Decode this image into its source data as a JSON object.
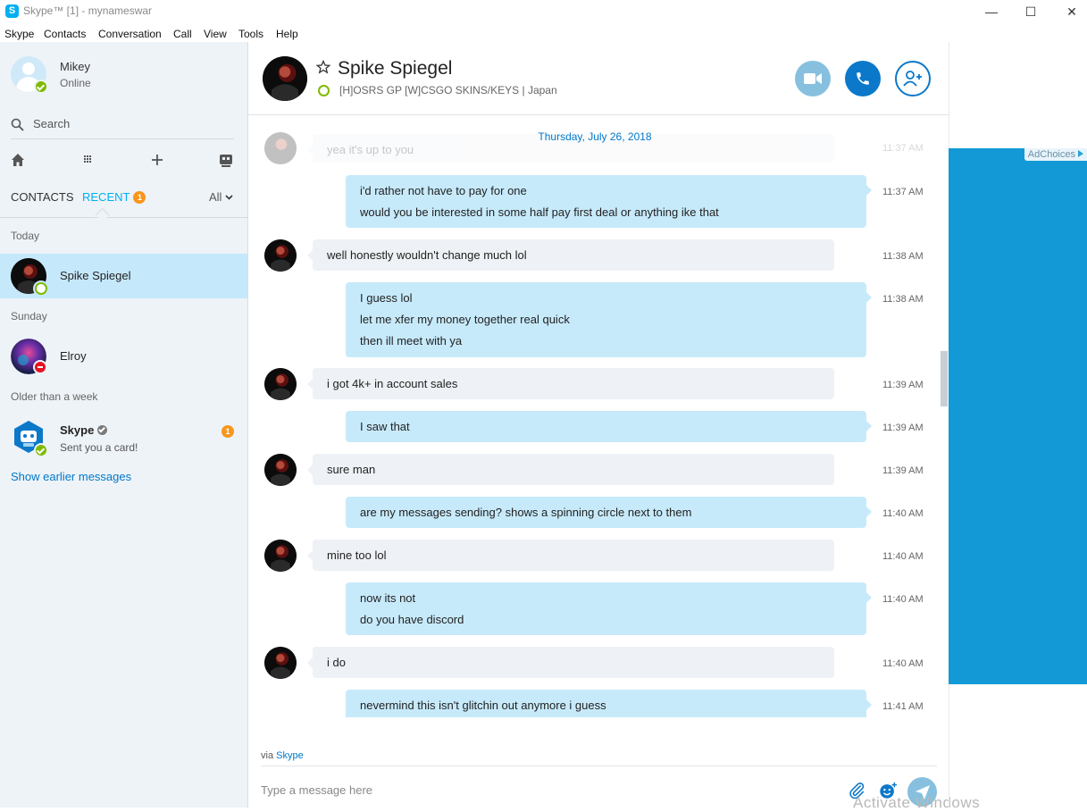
{
  "window": {
    "title": "Skype™ [1] - mynameswar",
    "logo_letter": "S",
    "controls": {
      "minimize": "—",
      "maximize": "☐",
      "close": "✕"
    }
  },
  "menu": [
    "Skype",
    "Contacts",
    "Conversation",
    "Call",
    "View",
    "Tools",
    "Help"
  ],
  "profile": {
    "name": "Mikey",
    "status": "Online"
  },
  "search": {
    "label": "Search"
  },
  "tabs": {
    "contacts": "CONTACTS",
    "recent": "RECENT",
    "recent_badge": "1",
    "filter": "All"
  },
  "groups": {
    "today": "Today",
    "sunday": "Sunday",
    "older": "Older than a week"
  },
  "contacts": [
    {
      "name": "Spike Spiegel",
      "subtitle": ""
    },
    {
      "name": "Elroy",
      "subtitle": ""
    },
    {
      "name": "Skype",
      "subtitle": "Sent you a card!",
      "badge": "1"
    }
  ],
  "show_earlier": "Show earlier messages",
  "conversation": {
    "name": "Spike Spiegel",
    "mood": "[H]OSRS GP [W]CSGO SKINS/KEYS | Japan",
    "date": "Thursday, July 26, 2018",
    "messages": [
      {
        "dir": "in",
        "lines": [
          "yea it's up to you"
        ],
        "time": "11:37 AM"
      },
      {
        "dir": "out",
        "lines": [
          "i'd rather not have to pay for one",
          "would you be interested in some half pay first deal or anything ike that"
        ],
        "time": "11:37 AM"
      },
      {
        "dir": "in",
        "lines": [
          "well honestly wouldn't change much lol"
        ],
        "time": "11:38 AM"
      },
      {
        "dir": "out",
        "lines": [
          "I guess lol",
          "let me xfer my money together real quick",
          "then ill meet with ya"
        ],
        "time": "11:38 AM"
      },
      {
        "dir": "in",
        "lines": [
          "i got 4k+ in account sales"
        ],
        "time": "11:39 AM"
      },
      {
        "dir": "out",
        "lines": [
          "I saw that"
        ],
        "time": "11:39 AM"
      },
      {
        "dir": "in",
        "lines": [
          "sure man"
        ],
        "time": "11:39 AM"
      },
      {
        "dir": "out",
        "lines": [
          "are my messages sending? shows a spinning circle next to them"
        ],
        "time": "11:40 AM"
      },
      {
        "dir": "in",
        "lines": [
          "mine too lol"
        ],
        "time": "11:40 AM"
      },
      {
        "dir": "out",
        "lines": [
          "now its not",
          "do you have discord"
        ],
        "time": "11:40 AM"
      },
      {
        "dir": "in",
        "lines": [
          "i do"
        ],
        "time": "11:40 AM"
      },
      {
        "dir": "out",
        "lines": [
          "nevermind this isn't glitchin out anymore i guess"
        ],
        "time": "11:41 AM"
      }
    ]
  },
  "footer": {
    "via_prefix": "via",
    "via_link": "Skype",
    "composer_placeholder": "Type a message here",
    "watermark": "Activate Windows"
  },
  "ad": {
    "adchoices": "AdChoices"
  },
  "colors": {
    "brand": "#00aff0",
    "call_button": "#0b78ca",
    "video_button": "#87c0df",
    "outgoing_bubble": "#c7eafb",
    "incoming_bubble": "#eef1f5",
    "selected_contact": "#c6e8fb",
    "online": "#7fba00",
    "badge": "#f8961d",
    "ad_background": "#139ad6"
  }
}
